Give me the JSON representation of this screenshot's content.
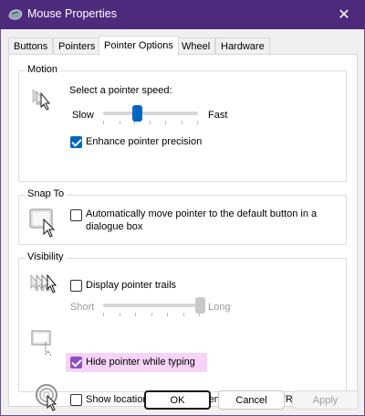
{
  "window": {
    "title": "Mouse Properties",
    "close_glyph": "✕",
    "accent": "#4d2a7c"
  },
  "tabs": [
    {
      "label": "Buttons",
      "active": false
    },
    {
      "label": "Pointers",
      "active": false
    },
    {
      "label": "Pointer Options",
      "active": true
    },
    {
      "label": "Wheel",
      "active": false
    },
    {
      "label": "Hardware",
      "active": false
    }
  ],
  "motion": {
    "legend": "Motion",
    "speed_label": "Select a pointer speed:",
    "slow_label": "Slow",
    "fast_label": "Fast",
    "speed_value": 0.36,
    "precision_label": "Enhance pointer precision",
    "precision_checked": true,
    "icon": "pointer-speed-icon"
  },
  "snap": {
    "legend": "Snap To",
    "label_line1": "Automatically move pointer to the default button in a",
    "label_line2": "dialogue box",
    "checked": false,
    "icon": "snap-to-button-icon"
  },
  "visibility": {
    "legend": "Visibility",
    "trails_label": "Display pointer trails",
    "trails_checked": false,
    "short_label": "Short",
    "long_label": "Long",
    "trail_value": 1.0,
    "hide_label": "Hide pointer while typing",
    "hide_checked": true,
    "hide_highlight": "#f6d3f7",
    "location_label": "Show location of pointer when I press the CTRL key",
    "location_checked": false
  },
  "buttons": {
    "ok": "OK",
    "cancel": "Cancel",
    "apply": "Apply"
  }
}
